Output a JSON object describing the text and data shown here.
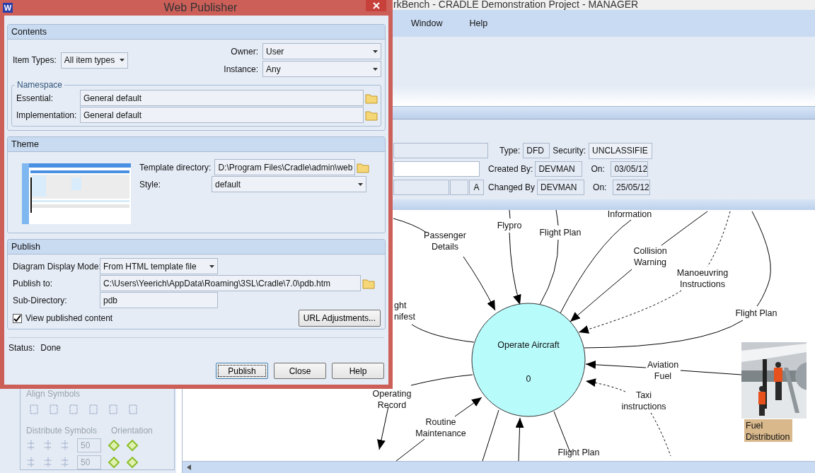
{
  "app": {
    "title": "rkBench - CRADLE Demonstration Project - MANAGER",
    "menu": [
      "Window",
      "Help"
    ],
    "details": {
      "type": {
        "label": "Type:",
        "value": "DFD"
      },
      "security": {
        "label": "Security:",
        "value": "UNCLASSIFIE"
      },
      "created_by": {
        "label": "Created By:",
        "value": "DEVMAN"
      },
      "created_on": {
        "label": "On:",
        "value": "03/05/12"
      },
      "changed_by": {
        "label": "Changed By",
        "value": "DEVMAN"
      },
      "changed_on": {
        "label": "On:",
        "value": "25/05/12"
      },
      "flag": "A"
    },
    "tools": {
      "align_heading": "Align Symbols",
      "distribute_heading": "Distribute Symbols",
      "orientation_heading": "Orientation",
      "spacing": [
        {
          "value": "50",
          "disabled": true
        },
        {
          "value": "50",
          "disabled": true
        }
      ]
    },
    "diagram": {
      "process": {
        "name": "Operate Aircraft",
        "number": "0"
      },
      "flows": [
        {
          "lines": [
            "Passenger",
            "Details"
          ],
          "dashed": false
        },
        {
          "lines": [
            "Flypro"
          ],
          "dashed": false
        },
        {
          "lines": [
            "Flight Plan"
          ],
          "dashed": false
        },
        {
          "lines": [
            "Information"
          ],
          "dashed": false
        },
        {
          "lines": [
            "Collision",
            "Warning"
          ],
          "dashed": false
        },
        {
          "lines": [
            "Manoeuvring",
            "Instructions"
          ],
          "dashed": true
        },
        {
          "lines": [
            "Flight Plan"
          ],
          "dashed": false
        },
        {
          "lines": [
            "Aviation",
            "Fuel"
          ],
          "dashed": false
        },
        {
          "lines": [
            "Taxi",
            "instructions"
          ],
          "dashed": true
        },
        {
          "lines": [
            "Routine",
            "Maintenance"
          ],
          "dashed": false
        },
        {
          "lines": [
            "Operating",
            "Record"
          ],
          "dashed": false
        },
        {
          "lines": [
            "Flight Plan"
          ],
          "dashed": false
        },
        {
          "lines": [
            "ght",
            "nifest"
          ],
          "dashed": false
        }
      ],
      "external": {
        "lines": [
          "Fuel",
          "Distribution"
        ],
        "selected": true
      }
    }
  },
  "dialog": {
    "icon_letter": "W",
    "title": "Web Publisher",
    "contents": {
      "heading": "Contents",
      "item_types": {
        "label": "Item Types:",
        "value": "All item types"
      },
      "owner": {
        "label": "Owner:",
        "value": "User"
      },
      "instance": {
        "label": "Instance:",
        "value": "Any"
      },
      "namespace": {
        "legend": "Namespace",
        "essential": {
          "label": "Essential:",
          "value": "General default"
        },
        "implementation": {
          "label": "Implementation:",
          "value": "General default"
        }
      }
    },
    "theme": {
      "heading": "Theme",
      "template_directory": {
        "label": "Template directory:",
        "value": "D:\\Program Files\\Cradle\\admin\\web"
      },
      "style": {
        "label": "Style:",
        "value": "default"
      }
    },
    "publish": {
      "heading": "Publish",
      "display_mode": {
        "label": "Diagram Display Mode:",
        "value": "From HTML template file"
      },
      "publish_to": {
        "label": "Publish to:",
        "value": "C:\\Users\\Yeerich\\AppData\\Roaming\\3SL\\Cradle\\7.0\\pdb.htm"
      },
      "sub_directory": {
        "label": "Sub-Directory:",
        "value": "pdb"
      },
      "view_published": {
        "label": "View published content",
        "checked": true
      },
      "url_button": "URL Adjustments..."
    },
    "status": {
      "label": "Status:",
      "value": "Done"
    },
    "buttons": [
      {
        "label": "Publish",
        "default": true
      },
      {
        "label": "Close",
        "default": false
      },
      {
        "label": "Help",
        "default": false
      }
    ]
  }
}
